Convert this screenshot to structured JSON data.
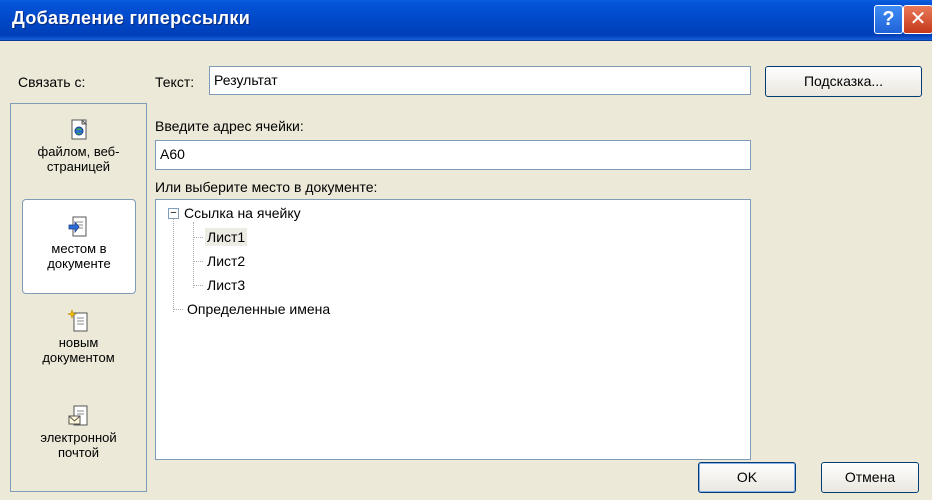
{
  "window": {
    "title": "Добавление гиперссылки",
    "help_icon": "question-icon",
    "close_icon": "close-icon",
    "accent": "#0048c8"
  },
  "left_panel": {
    "heading": "Связать с:",
    "items": [
      {
        "line1": "файлом, веб-",
        "line2": "страницей",
        "icon": "web-page-icon",
        "selected": false
      },
      {
        "line1": "местом в",
        "line2": "документе",
        "icon": "place-in-document-icon",
        "selected": true
      },
      {
        "line1": "новым",
        "line2": "документом",
        "icon": "new-document-icon",
        "selected": false
      },
      {
        "line1": "электронной",
        "line2": "почтой",
        "icon": "email-icon",
        "selected": false
      }
    ]
  },
  "text_field": {
    "label": "Текст:",
    "value": "Результат"
  },
  "hint_button": "Подсказка...",
  "address_field": {
    "label": "Введите адрес ячейки:",
    "value": "A60"
  },
  "place_label": "Или выберите место в документе:",
  "tree": {
    "root": "Ссылка на ячейку",
    "sheets": [
      "Лист1",
      "Лист2",
      "Лист3"
    ],
    "selected_sheet": "Лист1",
    "names": "Определенные имена"
  },
  "ok_button": "OK",
  "cancel_button": "Отмена"
}
